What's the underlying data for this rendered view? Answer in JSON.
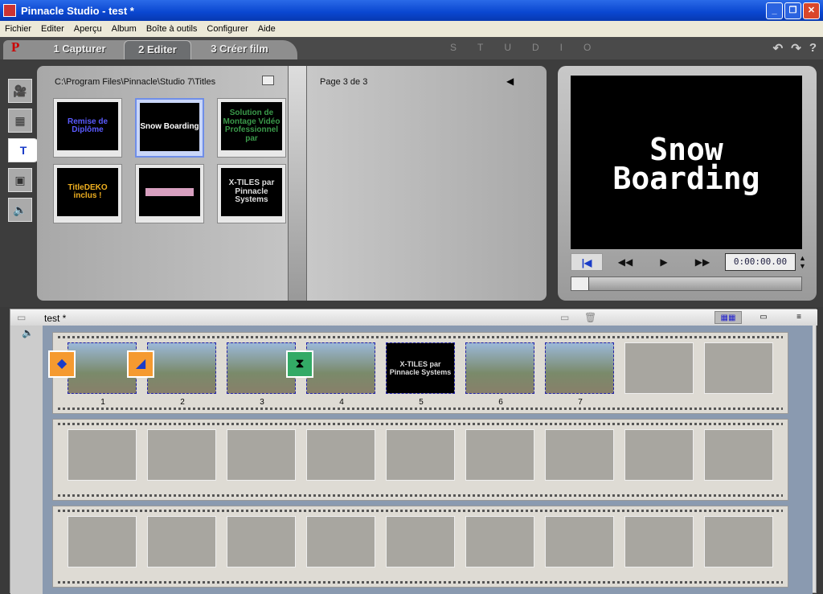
{
  "window": {
    "title": "Pinnacle Studio - test *",
    "minimize": "_",
    "maximize": "❐",
    "close": "✕"
  },
  "menu": [
    "Fichier",
    "Editer",
    "Aperçu",
    "Album",
    "Boîte à outils",
    "Configurer",
    "Aide"
  ],
  "tabs": {
    "logo": "P",
    "capture": "1 Capturer",
    "edit": "2 Editer",
    "create": "3 Créer film",
    "studio": "STUDIO",
    "undo": "↶",
    "redo": "↷",
    "help": "?"
  },
  "album": {
    "path": "C:\\Program Files\\Pinnacle\\Studio 7\\Titles",
    "page": "Page 3 de 3",
    "titles": [
      {
        "text": "Remise de Diplôme",
        "color": "#5a5aff"
      },
      {
        "text": "Snow Boarding",
        "color": "#ffffff"
      },
      {
        "text": "Solution de Montage Vidéo Professionnel par",
        "color": "#3a9a4a"
      },
      {
        "text": "TitleDEKO inclus !",
        "color": "#f0b020"
      },
      {
        "text": "",
        "color": "#d8a0c0"
      },
      {
        "text": "X-TILES par Pinnacle Systems",
        "color": "#dddddd"
      }
    ]
  },
  "player": {
    "screen_text": "Snow Boarding",
    "timecode": "0:00:00.00",
    "rewind": "◀◀",
    "play": "▶",
    "ffwd": "▶▶",
    "first": "|◀",
    "position": 0
  },
  "storyboard": {
    "title": "test *",
    "clips": [
      {
        "num": "1",
        "type": "video"
      },
      {
        "num": "2",
        "type": "video"
      },
      {
        "num": "3",
        "type": "video"
      },
      {
        "num": "4",
        "type": "video"
      },
      {
        "num": "5",
        "type": "title",
        "text": "X-TILES par Pinnacle Systems"
      },
      {
        "num": "6",
        "type": "video"
      },
      {
        "num": "7",
        "type": "video"
      }
    ],
    "empty_slots": 2
  }
}
